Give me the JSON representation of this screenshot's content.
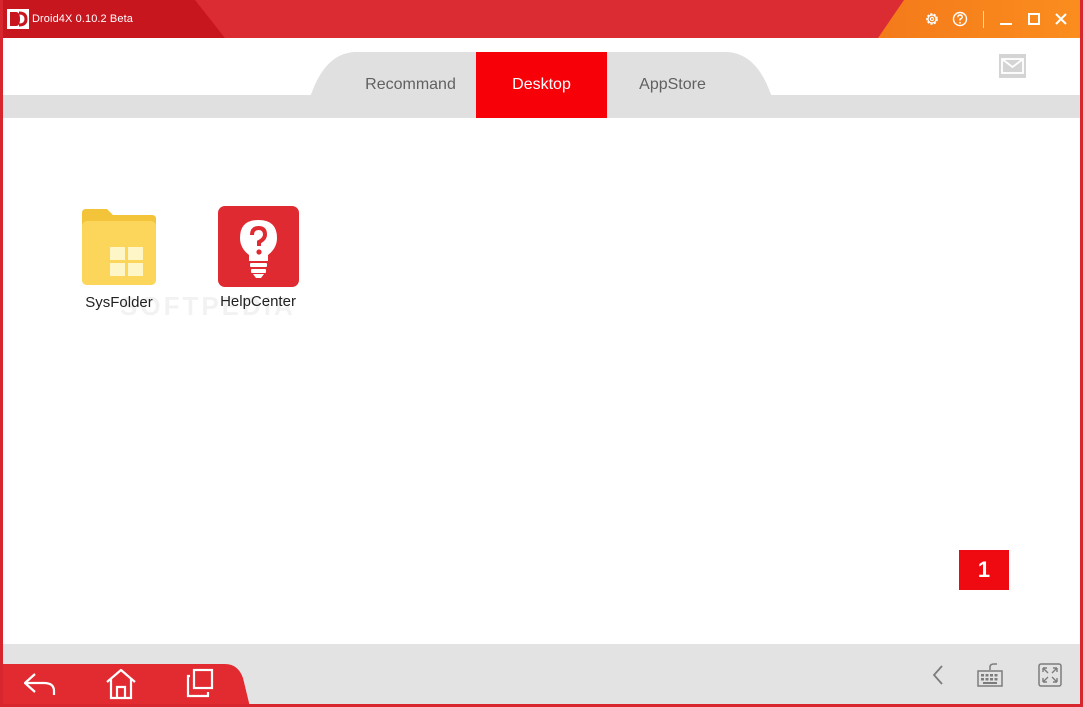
{
  "window": {
    "title": "Droid4X 0.10.2 Beta",
    "accent_color": "#dc2c33",
    "right_accent_color": "#fb8d1e",
    "controls": [
      "gear-icon",
      "help-icon",
      "minimize-icon",
      "maximize-icon",
      "close-icon"
    ]
  },
  "tabs": [
    {
      "label": "Recommand",
      "active": false
    },
    {
      "label": "Desktop",
      "active": true
    },
    {
      "label": "AppStore",
      "active": false
    }
  ],
  "header": {
    "mail_icon": "mail-icon"
  },
  "desktop": {
    "apps": [
      {
        "label": "SysFolder",
        "icon": "folder-icon"
      },
      {
        "label": "HelpCenter",
        "icon": "help-bulb-icon"
      }
    ],
    "watermark": "SOFTPEDIA",
    "page_number": "1"
  },
  "navbar": {
    "left": [
      "back-icon",
      "home-icon",
      "recent-apps-icon"
    ],
    "right": [
      "chevron-left-icon",
      "keyboard-icon",
      "fullscreen-icon"
    ]
  }
}
